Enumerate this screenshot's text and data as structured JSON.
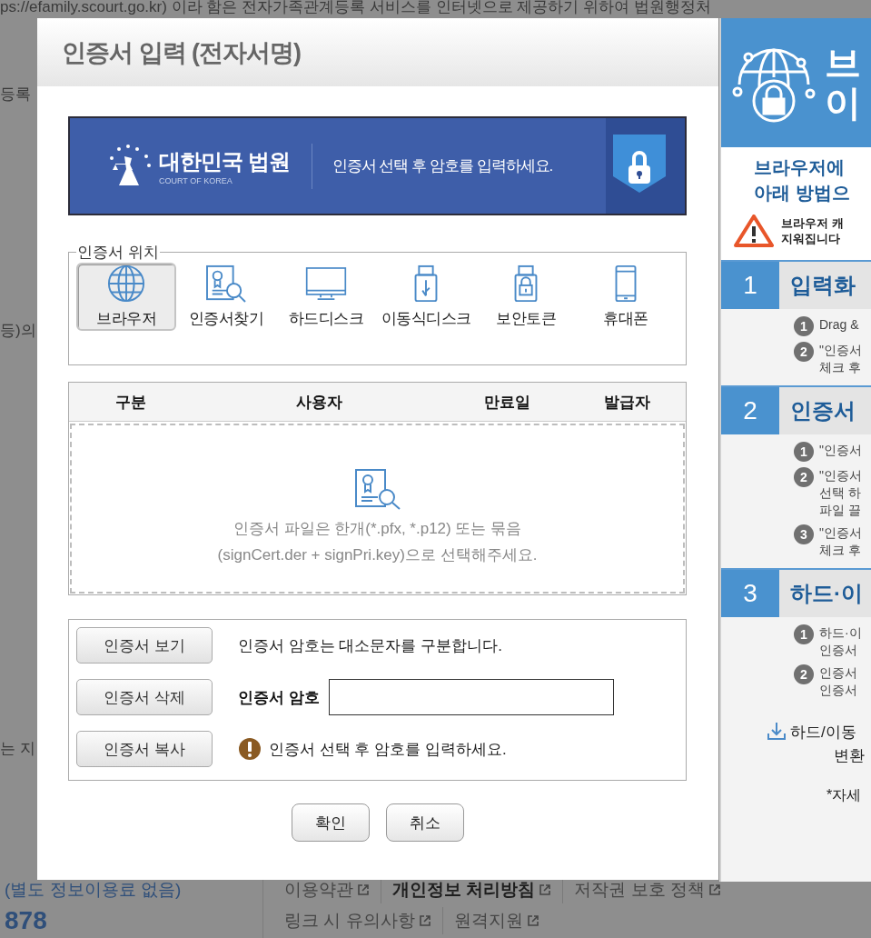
{
  "background_page": {
    "top_line": "ps://efamily.scourt.go.kr) 이라 함은 전자가족관계등록 서비스를 인터넷으로 제공하기 위하여 법원행정처",
    "side_snippets": [
      "등록",
      "등)의",
      "는 지"
    ],
    "fee_note": "(별도 정보이용료 없음)",
    "phone": "878",
    "footer_links": [
      [
        {
          "label": "이용약관",
          "emphasized": false
        },
        {
          "label": "개인정보 처리방침",
          "emphasized": true
        },
        {
          "label": "저작권 보호 정책",
          "emphasized": false
        }
      ],
      [
        {
          "label": "링크 시 유의사항",
          "emphasized": false
        },
        {
          "label": "원격지원",
          "emphasized": false
        }
      ]
    ]
  },
  "dialog": {
    "title": "인증서 입력 (전자서명)",
    "banner": {
      "org_name": "대한민국 법원",
      "org_subtitle": "COURT OF KOREA",
      "message": "인증서 선택 후 암호를 입력하세요."
    },
    "location_group": {
      "legend": "인증서 위치",
      "locations": [
        {
          "label": "브라우저",
          "kind": "globe",
          "selected": true
        },
        {
          "label": "인증서찾기",
          "kind": "certificate",
          "selected": false
        },
        {
          "label": "하드디스크",
          "kind": "monitor",
          "selected": false
        },
        {
          "label": "이동식디스크",
          "kind": "usb",
          "selected": false
        },
        {
          "label": "보안토큰",
          "kind": "token",
          "selected": false
        },
        {
          "label": "휴대폰",
          "kind": "phone",
          "selected": false
        }
      ]
    },
    "table": {
      "columns": [
        "구분",
        "사용자",
        "만료일",
        "발급자"
      ],
      "empty_lines": [
        "인증서 파일은 한개(*.pfx, *.p12) 또는 묶음",
        "(signCert.der + signPri.key)으로 선택해주세요."
      ]
    },
    "actions": [
      "인증서 보기",
      "인증서 삭제",
      "인증서 복사"
    ],
    "case_note": "인증서 암호는 대소문자를 구분합니다.",
    "password": {
      "label": "인증서 암호"
    },
    "warning": "인증서 선택 후 암호를 입력하세요.",
    "buttons": [
      "확인",
      "취소"
    ]
  },
  "help_panel": {
    "heading": [
      "브",
      "이"
    ],
    "intro": [
      "브라우저에",
      "아래 방법으"
    ],
    "warning": [
      "브라우저 캐",
      "지워집니다"
    ],
    "sections": [
      {
        "number": "1",
        "title": "입력화",
        "items": [
          {
            "number": "1",
            "lines": [
              "Drag &"
            ]
          },
          {
            "number": "2",
            "lines": [
              "\"인증서",
              "체크 후"
            ]
          }
        ]
      },
      {
        "number": "2",
        "title": "인증서",
        "items": [
          {
            "number": "1",
            "lines": [
              "\"인증서"
            ]
          },
          {
            "number": "2",
            "lines": [
              "\"인증서",
              "선택 하",
              "파일 끌"
            ]
          },
          {
            "number": "3",
            "lines": [
              "\"인증서",
              "체크 후"
            ]
          }
        ]
      },
      {
        "number": "3",
        "title": "하드·이",
        "items": [
          {
            "number": "1",
            "lines": [
              "하드·이",
              "인증서"
            ]
          },
          {
            "number": "2",
            "lines": [
              "인증서",
              "인증서"
            ]
          }
        ]
      }
    ],
    "download": [
      "하드/이동",
      "변환"
    ],
    "note": "*자세"
  }
}
